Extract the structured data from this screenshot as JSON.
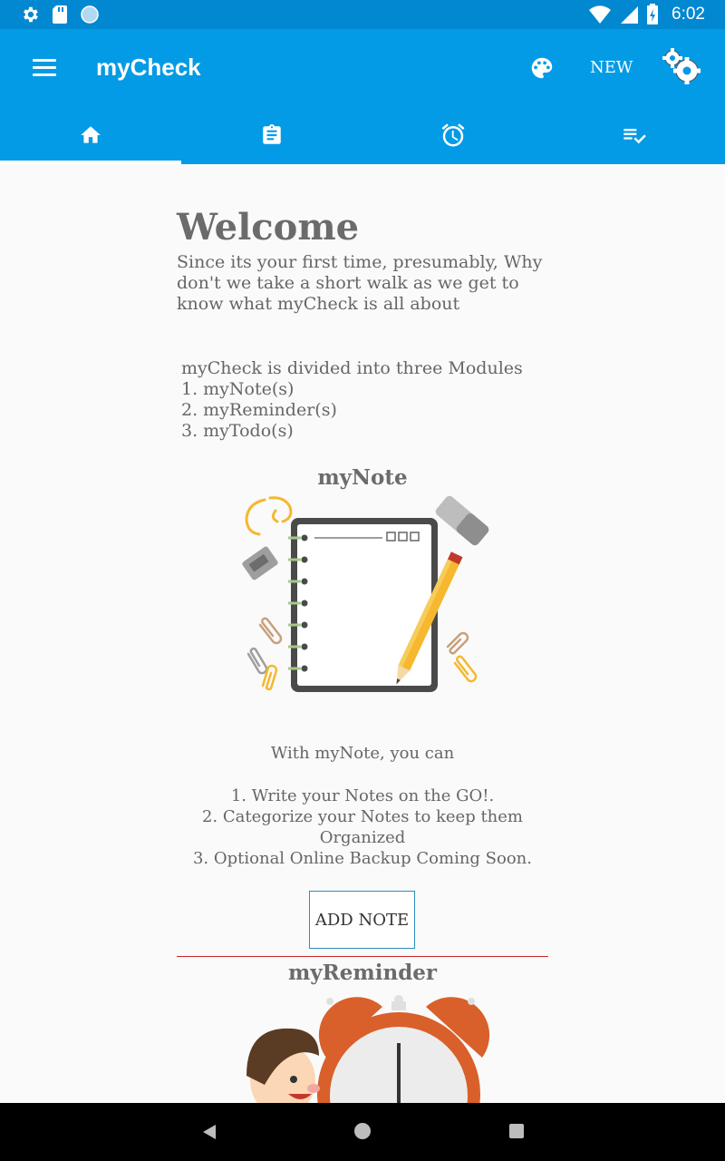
{
  "status_bar": {
    "time": "6:02",
    "left_icons": [
      "settings-icon",
      "sd-card-icon",
      "circle-icon"
    ],
    "right_icons": [
      "wifi-icon",
      "signal-icon",
      "battery-icon"
    ]
  },
  "app_bar": {
    "title": "myCheck",
    "new_label": "NEW",
    "color": "#039be5",
    "status_color": "#0288d1"
  },
  "tabs": [
    {
      "icon": "home-icon",
      "active": true
    },
    {
      "icon": "clipboard-icon",
      "active": false
    },
    {
      "icon": "alarm-icon",
      "active": false
    },
    {
      "icon": "playlist-check-icon",
      "active": false
    }
  ],
  "welcome": {
    "title": "Welcome",
    "text": "Since its your first time, presumably, Why don't we take a short walk as we get to know what myCheck is all about"
  },
  "modules": {
    "intro": "myCheck is divided into three Modules",
    "items": [
      "1. myNote(s)",
      "2. myReminder(s)",
      "3. myTodo(s)"
    ]
  },
  "my_note": {
    "title": "myNote",
    "intro": "With myNote, you can",
    "features": [
      "1. Write your Notes on the GO!.",
      "2. Categorize your Notes to keep them Organized",
      "3. Optional Online Backup Coming Soon."
    ],
    "button_label": "ADD NOTE"
  },
  "my_reminder": {
    "title": "myReminder"
  }
}
